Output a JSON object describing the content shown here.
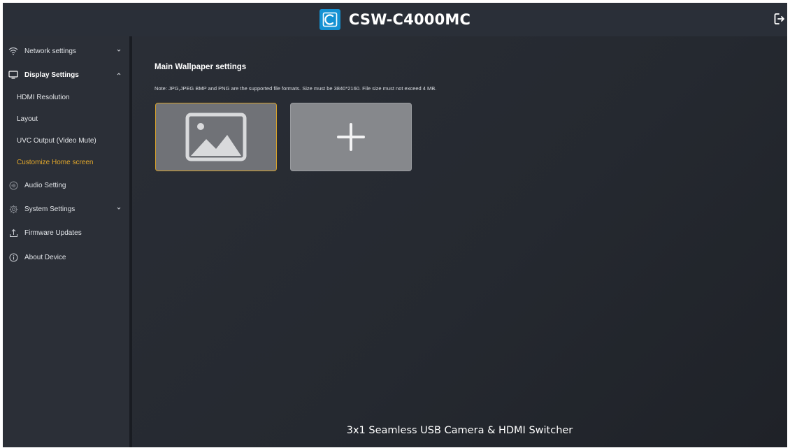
{
  "header": {
    "title": "CSW-C4000MC",
    "logo_icon": "brand-logo-icon",
    "logout_icon": "logout-icon"
  },
  "sidebar": {
    "items": [
      {
        "label": "Network settings",
        "icon": "wifi-icon",
        "chevron": "chevron-down-icon"
      },
      {
        "label": "Display Settings",
        "icon": "monitor-icon",
        "chevron": "chevron-up-icon"
      },
      {
        "label": "Audio Setting",
        "icon": "audio-icon"
      },
      {
        "label": "System Settings",
        "icon": "gear-icon",
        "chevron": "chevron-down-icon"
      },
      {
        "label": "Firmware Updates",
        "icon": "upload-icon"
      },
      {
        "label": "About Device",
        "icon": "info-icon"
      }
    ],
    "display_sub_items": [
      {
        "label": "HDMI Resolution"
      },
      {
        "label": "Layout"
      },
      {
        "label": "UVC Output (Video Mute)"
      },
      {
        "label": "Customize Home screen",
        "active": true
      }
    ]
  },
  "main": {
    "section_title": "Main Wallpaper settings",
    "note": "Note: JPG,JPEG BMP and PNG are the supported file formats. Size must be 3840*2160. File size must not exceed 4 MB.",
    "tiles": [
      {
        "kind": "wallpaper",
        "icon": "image-icon",
        "selected": true
      },
      {
        "kind": "add",
        "icon": "plus-icon"
      }
    ],
    "footer": "3x1 Seamless USB Camera & HDMI Switcher"
  },
  "colors": {
    "accent": "#e3a82b",
    "brand": "#1592d3",
    "background": "#22262e",
    "sidebar": "#2b2f37"
  }
}
